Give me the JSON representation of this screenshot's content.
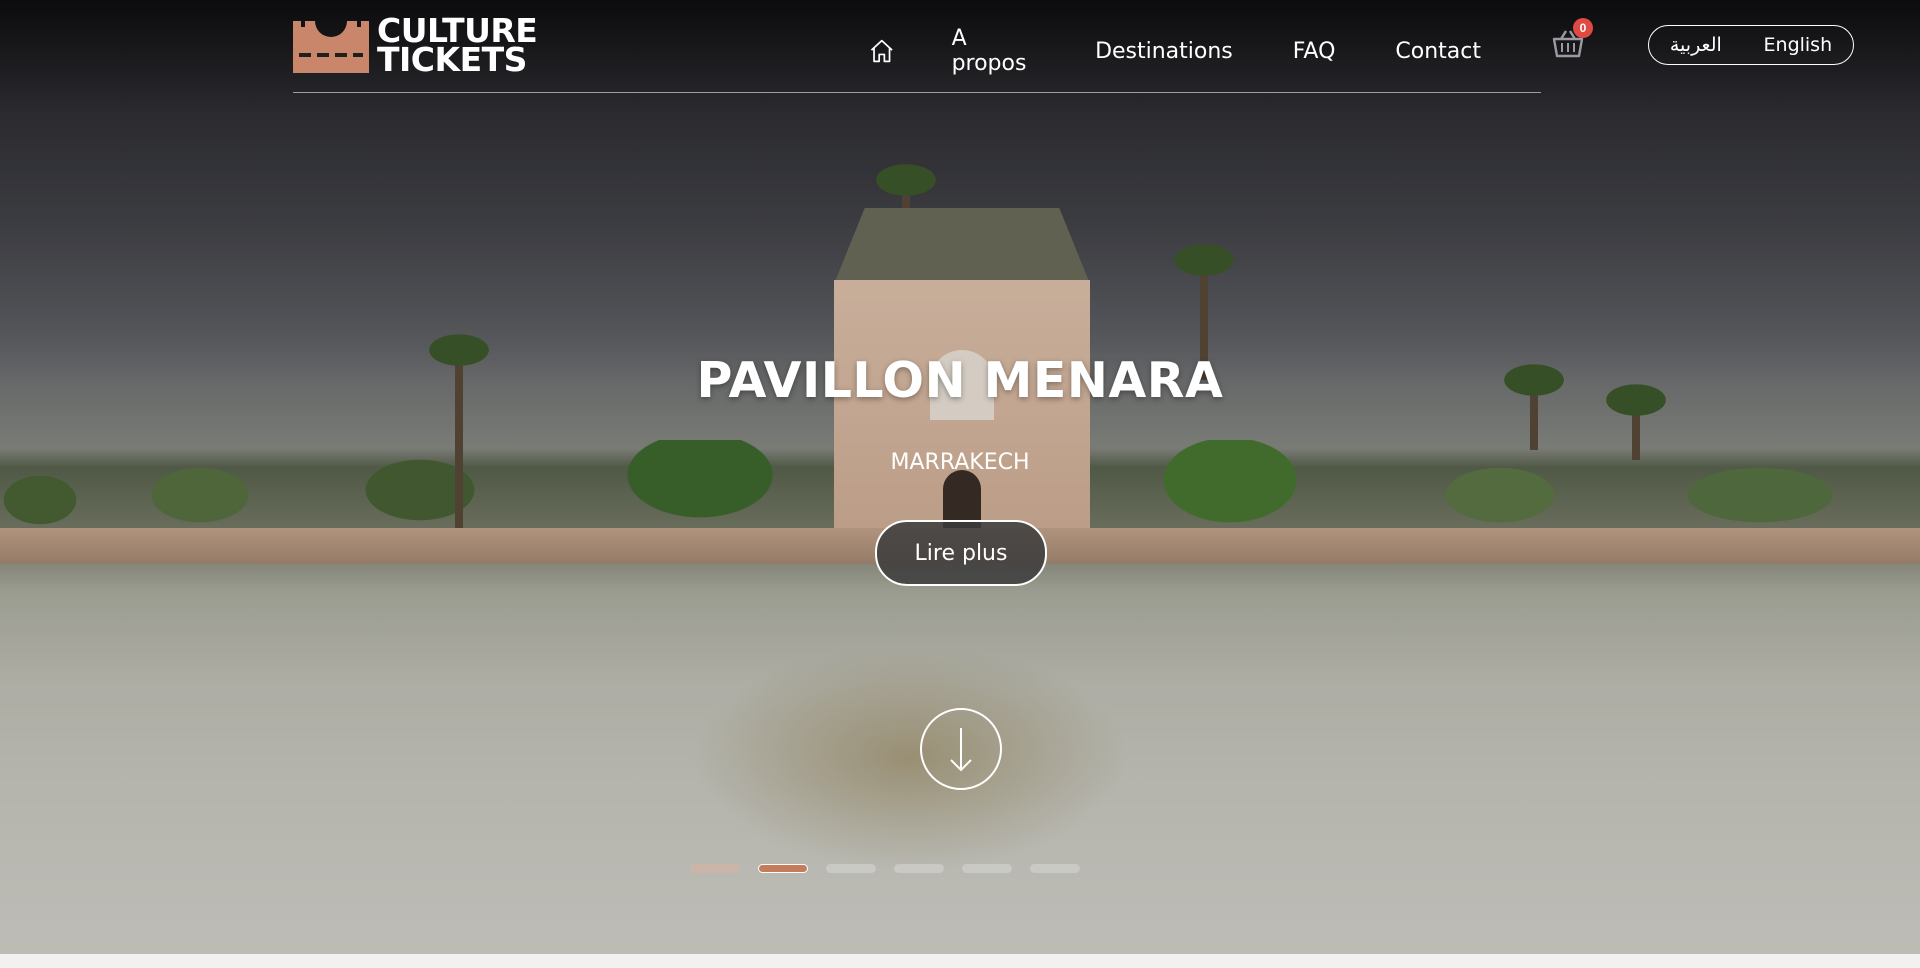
{
  "brand": {
    "line1": "CULTURE",
    "line2": "TICKETS",
    "accent_color": "#c9866a"
  },
  "nav": {
    "home_icon": "home-icon",
    "items": [
      {
        "label": "A propos"
      },
      {
        "label": "Destinations"
      },
      {
        "label": "FAQ"
      },
      {
        "label": "Contact"
      }
    ]
  },
  "cart": {
    "icon": "basket-icon",
    "count": "0"
  },
  "language": {
    "arabic": "العربية",
    "english": "English"
  },
  "hero": {
    "title": "PAVILLON MENARA",
    "subtitle": "MARRAKECH",
    "cta_label": "Lire plus",
    "scroll_icon": "arrow-down-icon",
    "slides_total": 6,
    "active_slide": 2
  }
}
